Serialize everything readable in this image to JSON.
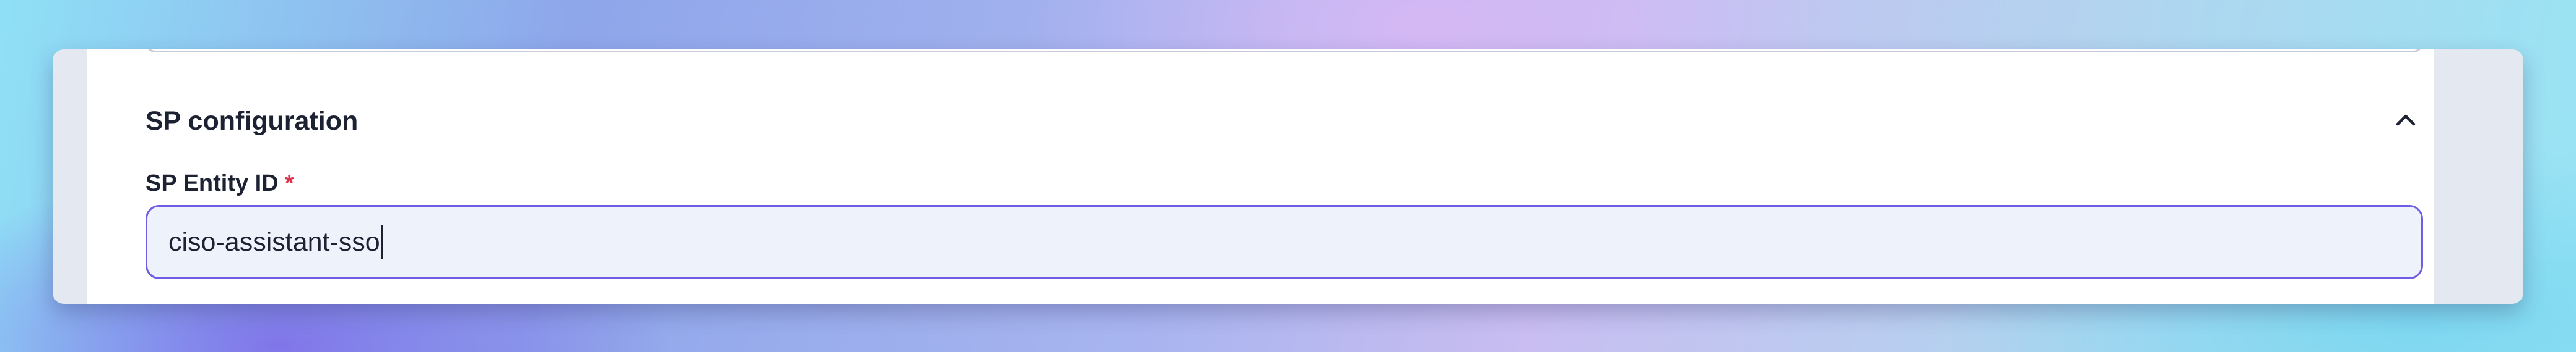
{
  "section": {
    "title": "SP configuration",
    "toggle_icon": "chevron-up-icon"
  },
  "field": {
    "label": "SP Entity ID",
    "required_marker": "*",
    "value": "ciso-assistant-sso"
  },
  "colors": {
    "input_border": "#6f5de6",
    "input_background": "#edf2fb",
    "required": "#e0314b"
  }
}
